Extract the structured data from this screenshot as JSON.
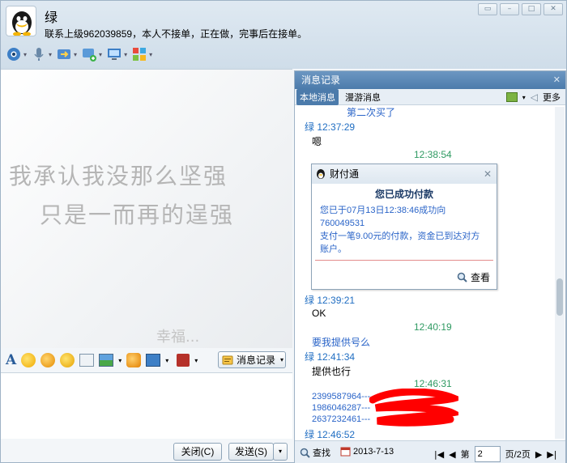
{
  "header": {
    "title": "绿",
    "status": "联系上级962039859，本人不接单，正在做，完事后在接单。"
  },
  "toolbar_icons": [
    "webcam-icon",
    "microphone-icon",
    "file-transfer-icon",
    "screen-share-icon",
    "remote-desktop-icon",
    "apps-icon"
  ],
  "chat_background": {
    "line1": "我承认我没那么坚强",
    "line2": "只是一而再的逞强",
    "corner": "幸福..."
  },
  "format_bar": {
    "message_record_label": "消息记录"
  },
  "buttons": {
    "close_label": "关闭(C)",
    "send_label": "发送(S)"
  },
  "history": {
    "title": "消息记录",
    "tab_local": "本地消息",
    "tab_roaming": "漫游消息",
    "more_label": "更多",
    "entries": {
      "l0": "第二次买了",
      "l1": "绿 12:37:29",
      "l2": "嗯",
      "l3": "12:38:54",
      "l4": "绿 12:39:21",
      "l5": "OK",
      "l6": "12:40:19",
      "l7": "要我提供号么",
      "l8": "绿 12:41:34",
      "l9": "提供也行",
      "l10": "12:46:31",
      "l11": "2399587964---",
      "l12": "1986046287---",
      "l13": "2637232461---",
      "l14": "绿 12:46:52"
    },
    "card": {
      "title": "财付通",
      "headline": "您已成功付款",
      "body_line1": "您已于07月13日12:38:46成功向760049531",
      "body_line2": "支付一笔9.00元的付款，资金已到达对方",
      "body_line3": "账户。",
      "view_label": "查看"
    },
    "footer": {
      "find_label": "查找",
      "date": "2013-7-13",
      "page_prefix": "第",
      "page_value": "2",
      "page_total": "页/2页"
    }
  },
  "colors": {
    "accent": "#4c7bab",
    "sender": "#1f6dc2",
    "self_time": "#2f9a62",
    "link": "#2a64c8",
    "redaction": "#ff0000"
  }
}
